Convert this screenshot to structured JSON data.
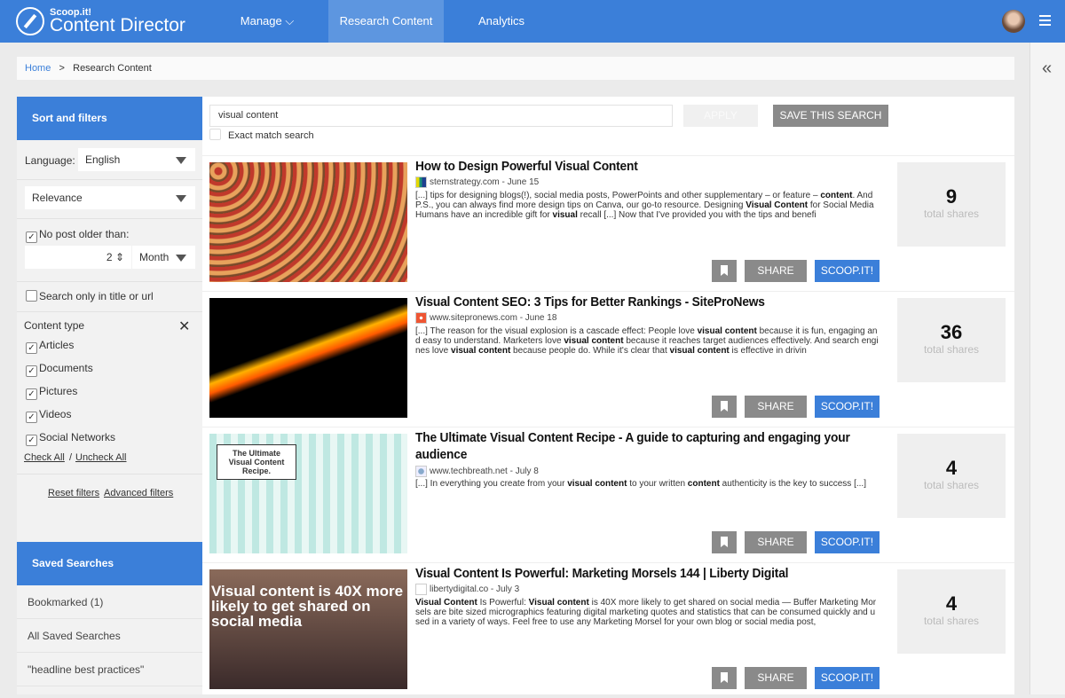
{
  "nav": {
    "logo_small": "Scoop.it!",
    "logo_big": "Content Director",
    "items": [
      "Manage ⌵",
      "Research Content",
      "Analytics"
    ],
    "accent": "#3b7fd9"
  },
  "breadcrumb": {
    "home": "Home",
    "sep": ">",
    "current": "Research Content"
  },
  "right_panel": {
    "collapse_icon": "«"
  },
  "sidebar": {
    "title": "Sort and filters",
    "language_label": "Language:",
    "language": "English",
    "sort": "Relevance",
    "no_older_label": "No post older than:",
    "no_older_value": "2",
    "no_older_unit": "Month",
    "title_only_label": "Search only in title or url",
    "content_type_label": "Content type",
    "content_types": [
      "Articles",
      "Documents",
      "Pictures",
      "Videos",
      "Social Networks"
    ],
    "check_all": "Check All",
    "slash": "/",
    "uncheck_all": "Uncheck All",
    "reset": "Reset filters",
    "advanced": "Advanced filters",
    "saved_title": "Saved Searches",
    "saved": [
      "Bookmarked (1)",
      "All Saved Searches",
      "\"headline best practices\""
    ]
  },
  "search": {
    "value": "visual content",
    "apply": "APPLY",
    "save": "SAVE THIS SEARCH",
    "exact": "Exact match search"
  },
  "buttons": {
    "share": "SHARE",
    "scoop": "SCOOP.IT!"
  },
  "articles": [
    {
      "title": [
        {
          "t": "How to Design Powerful "
        },
        {
          "t": "Visual Content",
          "b": 1
        }
      ],
      "source": "sternstrategy.com - June 15",
      "shares": "9",
      "shares_label": "total shares",
      "snippet": [
        {
          "t": "[...] tips for designing blogs(!), social media posts, PowerPoints and other supplementary – or feature – "
        },
        {
          "t": "content",
          "b": 1
        },
        {
          "t": ". And P.S., you can always find more design tips on Canva, our go-to resource. Designing "
        },
        {
          "t": "Visual Content",
          "b": 1
        },
        {
          "t": " for Social Media Humans have an incredible gift for "
        },
        {
          "t": "visual",
          "b": 1
        },
        {
          "t": " recall [...] Now that I've provided you with the tips and benefi"
        }
      ]
    },
    {
      "title": [
        {
          "t": "Visual Content",
          "b": 1
        },
        {
          "t": " SEO: 3 Tips for Better Rankings - SiteProNews"
        }
      ],
      "source": "www.sitepronews.com - June 18",
      "shares": "36",
      "shares_label": "total shares",
      "snippet": [
        {
          "t": "[...] The reason for the visual explosion is a cascade effect: People love "
        },
        {
          "t": "visual content",
          "b": 1
        },
        {
          "t": " because it is fun, engaging and easy to understand. Marketers love "
        },
        {
          "t": "visual content",
          "b": 1
        },
        {
          "t": " because it reaches target audiences effectively. And search engines love "
        },
        {
          "t": "visual content",
          "b": 1
        },
        {
          "t": " because people do. While it's clear that "
        },
        {
          "t": "visual content",
          "b": 1
        },
        {
          "t": " is effective in drivin"
        }
      ]
    },
    {
      "title": [
        {
          "t": "The Ultimate "
        },
        {
          "t": "Visual Content",
          "b": 1
        },
        {
          "t": " Recipe - A guide to capturing and engaging your audience"
        }
      ],
      "source": "www.techbreath.net - July 8",
      "shares": "4",
      "shares_label": "total shares",
      "image_text": "The Ultimate Visual Content Recipe.",
      "snippet": [
        {
          "t": "[...] In everything you create from your "
        },
        {
          "t": "visual content",
          "b": 1
        },
        {
          "t": " to your written "
        },
        {
          "t": "content",
          "b": 1
        },
        {
          "t": " authenticity is the key to success [...]"
        }
      ]
    },
    {
      "title": [
        {
          "t": "Visual Content",
          "b": 1
        },
        {
          "t": " Is Powerful: Marketing Morsels 144 | Liberty Digital"
        }
      ],
      "source": "libertydigital.co - July 3",
      "shares": "4",
      "shares_label": "total shares",
      "image_text": "Visual content is 40X more likely to get shared on social media",
      "snippet": [
        {
          "t": "Visual Content",
          "b": 1
        },
        {
          "t": " Is Powerful: "
        },
        {
          "t": "Visual content",
          "b": 1
        },
        {
          "t": " is 40X more likely to get shared on social media — Buffer Marketing Morsels are bite sized micrographics featuring digital marketing quotes and statistics that can be consumed quickly and used in a variety of ways. Feel free to use any Marketing Morsel for your own blog or social media post,"
        }
      ]
    }
  ]
}
